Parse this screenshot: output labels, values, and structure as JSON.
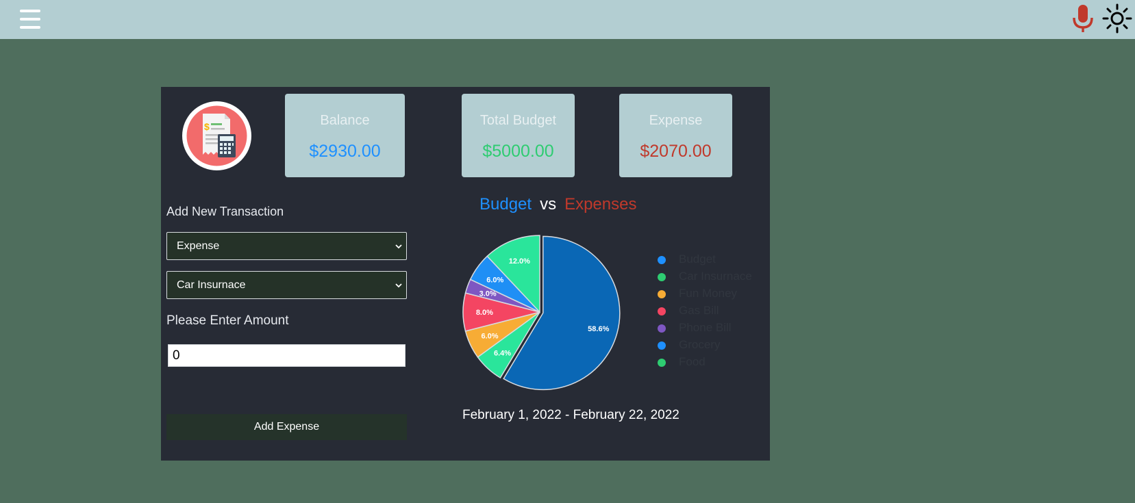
{
  "topbar": {
    "menu_icon": "hamburger-menu-icon",
    "mic_icon": "microphone-icon",
    "theme_icon": "sun-icon",
    "mic_color": "#c0392b"
  },
  "stats": {
    "balance": {
      "label": "Balance",
      "value": "$2930.00",
      "color": "#1e90ff"
    },
    "budget": {
      "label": "Total Budget",
      "value": "$5000.00",
      "color": "#2ecc71"
    },
    "expense": {
      "label": "Expense",
      "value": "$2070.00",
      "color": "#c0392b"
    }
  },
  "form": {
    "title": "Add New Transaction",
    "type_selected": "Expense",
    "category_selected": "Car Insurnace",
    "amount_label": "Please Enter Amount",
    "amount_value": "0",
    "submit_label": "Add Expense"
  },
  "chart": {
    "title_budget": "Budget",
    "title_vs": "vs",
    "title_expenses": "Expenses",
    "date_range": "February 1, 2022 - February 22, 2022"
  },
  "chart_data": {
    "type": "pie",
    "title": "Budget vs Expenses",
    "legend_position": "right",
    "slices": [
      {
        "label": "Budget",
        "percent": 58.6,
        "color": "#0a67b5"
      },
      {
        "label": "Car Insurnace",
        "percent": 6.4,
        "color": "#2ae59b"
      },
      {
        "label": "Fun Money",
        "percent": 6.0,
        "color": "#f7ac35"
      },
      {
        "label": "Gas Bill",
        "percent": 8.0,
        "color": "#f44562"
      },
      {
        "label": "Phone Bill",
        "percent": 3.0,
        "color": "#7e57c2"
      },
      {
        "label": "Grocery",
        "percent": 6.0,
        "color": "#1f8ff5"
      },
      {
        "label": "Food",
        "percent": 12.0,
        "color": "#2ae59b"
      }
    ],
    "legend": [
      {
        "label": "Budget",
        "color": "#1e90ff"
      },
      {
        "label": "Car Insurnace",
        "color": "#2ecc71"
      },
      {
        "label": "Fun Money",
        "color": "#f7ac35"
      },
      {
        "label": "Gas Bill",
        "color": "#f44562"
      },
      {
        "label": "Phone Bill",
        "color": "#7e57c2"
      },
      {
        "label": "Grocery",
        "color": "#1e90ff"
      },
      {
        "label": "Food",
        "color": "#2ecc71"
      }
    ]
  }
}
